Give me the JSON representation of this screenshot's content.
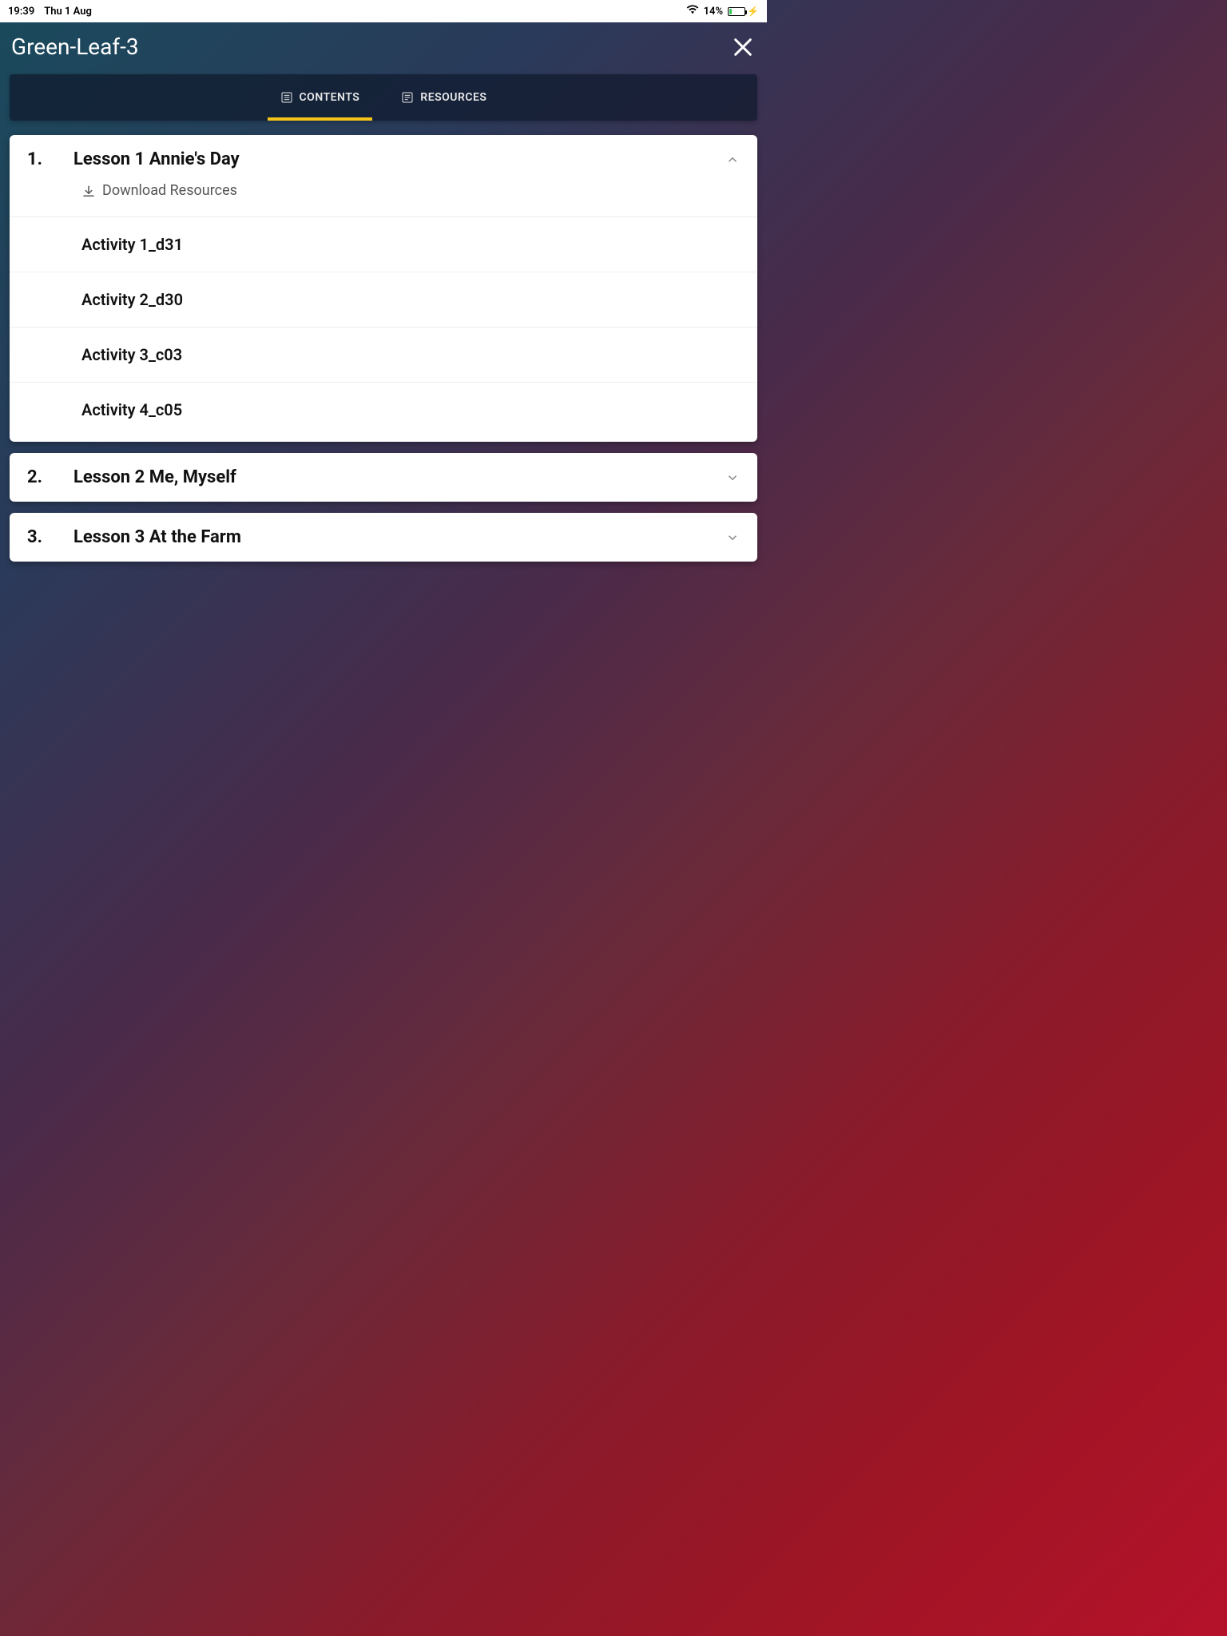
{
  "status_bar": {
    "time": "19:39",
    "date": "Thu 1 Aug",
    "battery_pct": "14%"
  },
  "header": {
    "title": "Green-Leaf-3"
  },
  "tabs": {
    "contents": "CONTENTS",
    "resources": "RESOURCES"
  },
  "lessons": [
    {
      "num": "1.",
      "title": "Lesson 1 Annie's Day",
      "expanded": true,
      "download_label": "Download Resources",
      "activities": [
        "Activity 1_d31",
        "Activity 2_d30",
        "Activity 3_c03",
        "Activity 4_c05"
      ]
    },
    {
      "num": "2.",
      "title": "Lesson 2 Me, Myself",
      "expanded": false
    },
    {
      "num": "3.",
      "title": "Lesson 3 At the Farm",
      "expanded": false
    }
  ]
}
